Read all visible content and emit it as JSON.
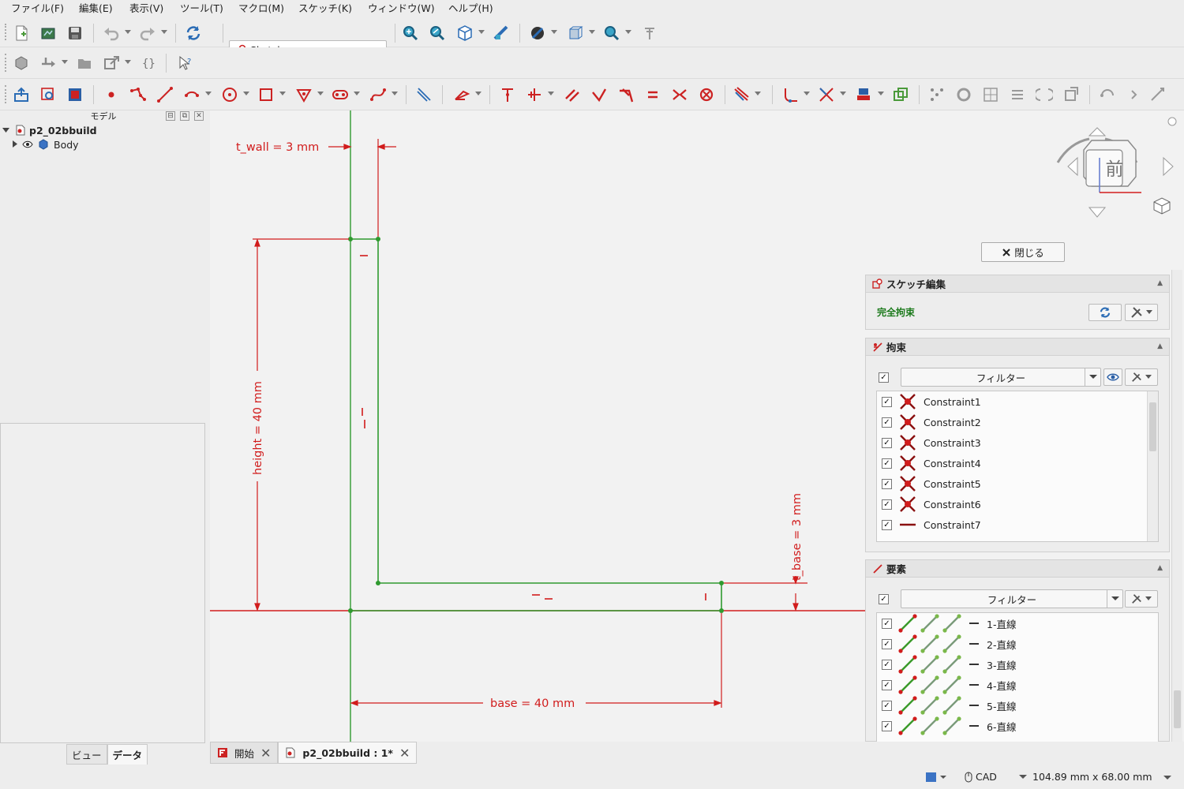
{
  "menu": [
    "ファイル(F)",
    "編集(E)",
    "表示(V)",
    "ツール(T)",
    "マクロ(M)",
    "スケッチ(K)",
    "ウィンドウ(W)",
    "ヘルプ(H)"
  ],
  "workbench": {
    "selected": "Sketcher"
  },
  "tree": {
    "header": "モデル",
    "document": "p2_02bbuild",
    "body": "Body"
  },
  "left_tabs": {
    "view": "ビュー",
    "data": "データ"
  },
  "sketch": {
    "dim_t_wall": "t_wall = 3 mm",
    "dim_height": "height = 40 mm",
    "dim_base": "base = 40 mm",
    "dim_t_base": "t_base = 3 mm"
  },
  "navcube": {
    "face_label": "前"
  },
  "close_button": "閉じる",
  "panels": {
    "sketch_edit": {
      "title": "スケッチ編集",
      "status": "完全拘束"
    },
    "constraints": {
      "title": "拘束",
      "filter_label": "フィルター",
      "items": [
        {
          "name": "Constraint1",
          "checked": true,
          "icon": "coincident-icon"
        },
        {
          "name": "Constraint2",
          "checked": true,
          "icon": "coincident-icon"
        },
        {
          "name": "Constraint3",
          "checked": true,
          "icon": "coincident-icon"
        },
        {
          "name": "Constraint4",
          "checked": true,
          "icon": "coincident-icon"
        },
        {
          "name": "Constraint5",
          "checked": true,
          "icon": "coincident-icon"
        },
        {
          "name": "Constraint6",
          "checked": true,
          "icon": "coincident-icon"
        },
        {
          "name": "Constraint7",
          "checked": true,
          "icon": "horizontal-icon"
        }
      ]
    },
    "elements": {
      "title": "要素",
      "filter_label": "フィルター",
      "items": [
        {
          "name": "1-直線",
          "checked": true
        },
        {
          "name": "2-直線",
          "checked": true
        },
        {
          "name": "3-直線",
          "checked": true
        },
        {
          "name": "4-直線",
          "checked": true
        },
        {
          "name": "5-直線",
          "checked": true
        },
        {
          "name": "6-直線",
          "checked": true
        }
      ]
    }
  },
  "doc_tabs": [
    {
      "label": "開始",
      "active": false
    },
    {
      "label": "p2_02bbuild : 1*",
      "active": true
    }
  ],
  "status": {
    "nav_style": "CAD",
    "dimensions": "104.89 mm x 68.00 mm"
  },
  "colors": {
    "constraint_red": "#d11c1c",
    "geometry_green": "#2f9a2f",
    "status_green": "#1c7a1c"
  }
}
